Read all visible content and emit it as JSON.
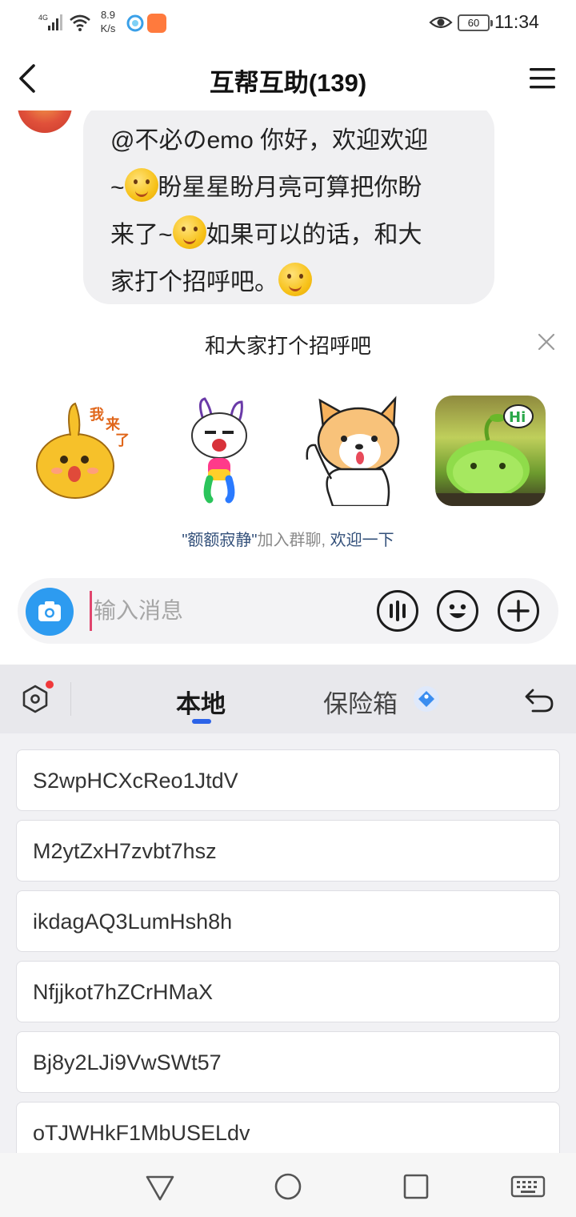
{
  "status_bar": {
    "network": "4G",
    "speed_value": "8.9",
    "speed_unit": "K/s",
    "battery": "60",
    "time": "11:34"
  },
  "header": {
    "title": "互帮互助(139)"
  },
  "chat": {
    "message_lines": [
      "@不必のemo⁣ 你好，欢迎欢迎",
      "~",
      "盼星星盼月亮可算把你盼",
      "来了~",
      "如果可以的话，和大",
      "家打个招呼吧。"
    ],
    "greet_title": "和大家打个招呼吧",
    "stickers": [
      "sticker-cat-wo-lai-le",
      "sticker-rainbow-rabbit",
      "sticker-corgi-wave",
      "sticker-green-sprout-hi"
    ],
    "join_note": {
      "name": "\"额额寂静\"",
      "text": "加入群聊,",
      "link": "欢迎一下"
    },
    "input_placeholder": "输入消息"
  },
  "keyboard_panel": {
    "tab_local": "本地",
    "tab_safe": "保险箱",
    "clips": [
      "S2wpHCXcReo1JtdV",
      "M2ytZxH7zvbt7hsz",
      "ikdagAQ3LumHsh8h",
      "Nfjjkot7hZCrHMaX",
      "Bj8y2LJi9VwSWt57",
      "oTJWHkF1MbUSELdv"
    ]
  },
  "colors": {
    "accent_blue": "#2c63e8",
    "camera_blue": "#2d9bf0",
    "badge_red": "#f0383a",
    "cursor_pink": "#e0456d"
  }
}
